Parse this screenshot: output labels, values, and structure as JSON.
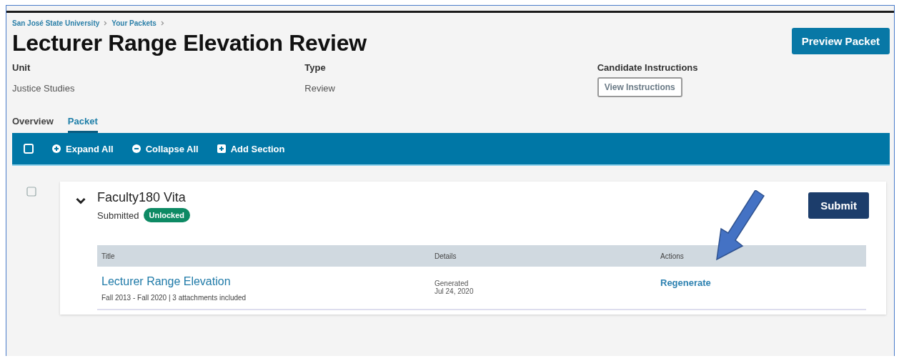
{
  "breadcrumbs": [
    "San José State University",
    "Your Packets"
  ],
  "title": "Lecturer Range Elevation Review",
  "preview_button": "Preview Packet",
  "fields": [
    {
      "label": "Unit",
      "value": "Justice Studies"
    },
    {
      "label": "Type",
      "value": "Review"
    }
  ],
  "instructions": {
    "label": "Candidate Instructions",
    "button": "View Instructions"
  },
  "tabs": [
    {
      "label": "Overview",
      "selected": false
    },
    {
      "label": "Packet",
      "selected": true
    }
  ],
  "toolbar": {
    "select_all_checked": false,
    "actions": [
      {
        "kind": "expand",
        "label": "Expand All"
      },
      {
        "kind": "collapse",
        "label": "Collapse All"
      },
      {
        "kind": "add",
        "label": "Add Section"
      }
    ]
  },
  "section": {
    "checked": false,
    "expanded": true,
    "title": "Faculty180 Vita",
    "status": "Submitted",
    "badge": "Unlocked",
    "submit_button": "Submit",
    "table": {
      "columns": [
        "Title",
        "Details",
        "Actions"
      ],
      "rows": [
        {
          "title": "Lecturer Range Elevation",
          "subtitle": "Fall 2013 - Fall 2020 | 3 attachments included",
          "details": [
            "Generated",
            "Jul 24, 2020"
          ],
          "action": "Regenerate"
        }
      ]
    }
  }
}
